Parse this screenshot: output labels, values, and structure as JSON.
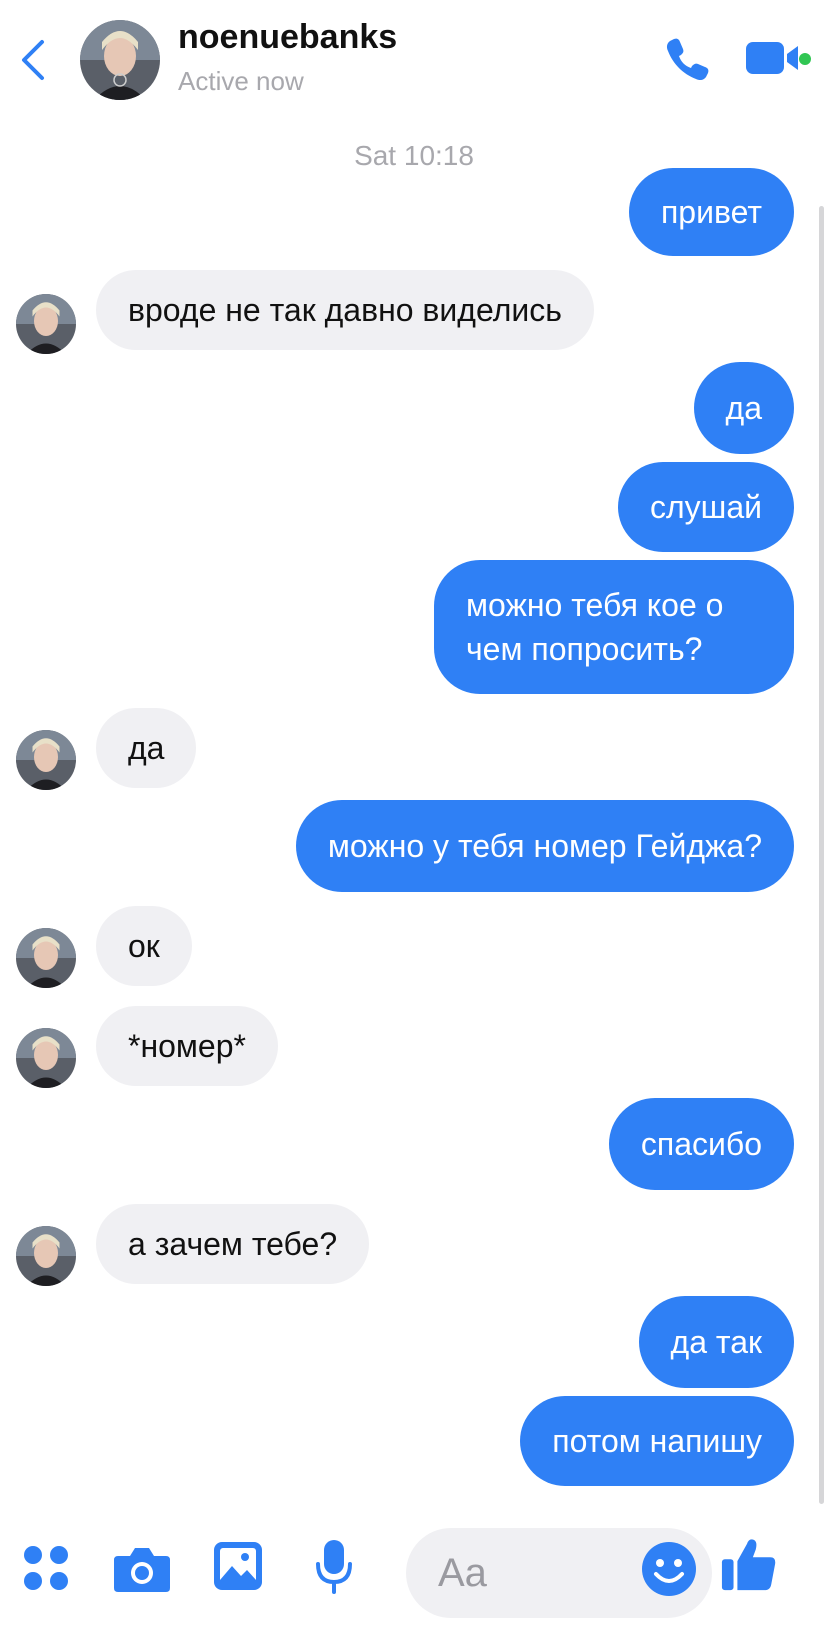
{
  "header": {
    "name": "noenuebanks",
    "status": "Active now"
  },
  "timestamp": "Sat 10:18",
  "messages": [
    {
      "dir": "out",
      "text": "привет"
    },
    {
      "dir": "in",
      "text": "вроде не так давно виделись"
    },
    {
      "dir": "out",
      "text": "да"
    },
    {
      "dir": "out",
      "text": "слушай"
    },
    {
      "dir": "out",
      "text": "можно тебя кое о чем попросить?"
    },
    {
      "dir": "in",
      "text": "да"
    },
    {
      "dir": "out",
      "text": "можно у тебя номер Гейджа?"
    },
    {
      "dir": "in",
      "text": "ок"
    },
    {
      "dir": "in",
      "text": "*номер*"
    },
    {
      "dir": "out",
      "text": "спасибо"
    },
    {
      "dir": "in",
      "text": "а зачем тебе?"
    },
    {
      "dir": "out",
      "text": "да так"
    },
    {
      "dir": "out",
      "text": "потом напишу"
    }
  ],
  "composer": {
    "placeholder": "Aa"
  },
  "colors": {
    "accent": "#2f80f5",
    "incoming_bubble": "#f0f0f3",
    "online": "#31c653"
  }
}
